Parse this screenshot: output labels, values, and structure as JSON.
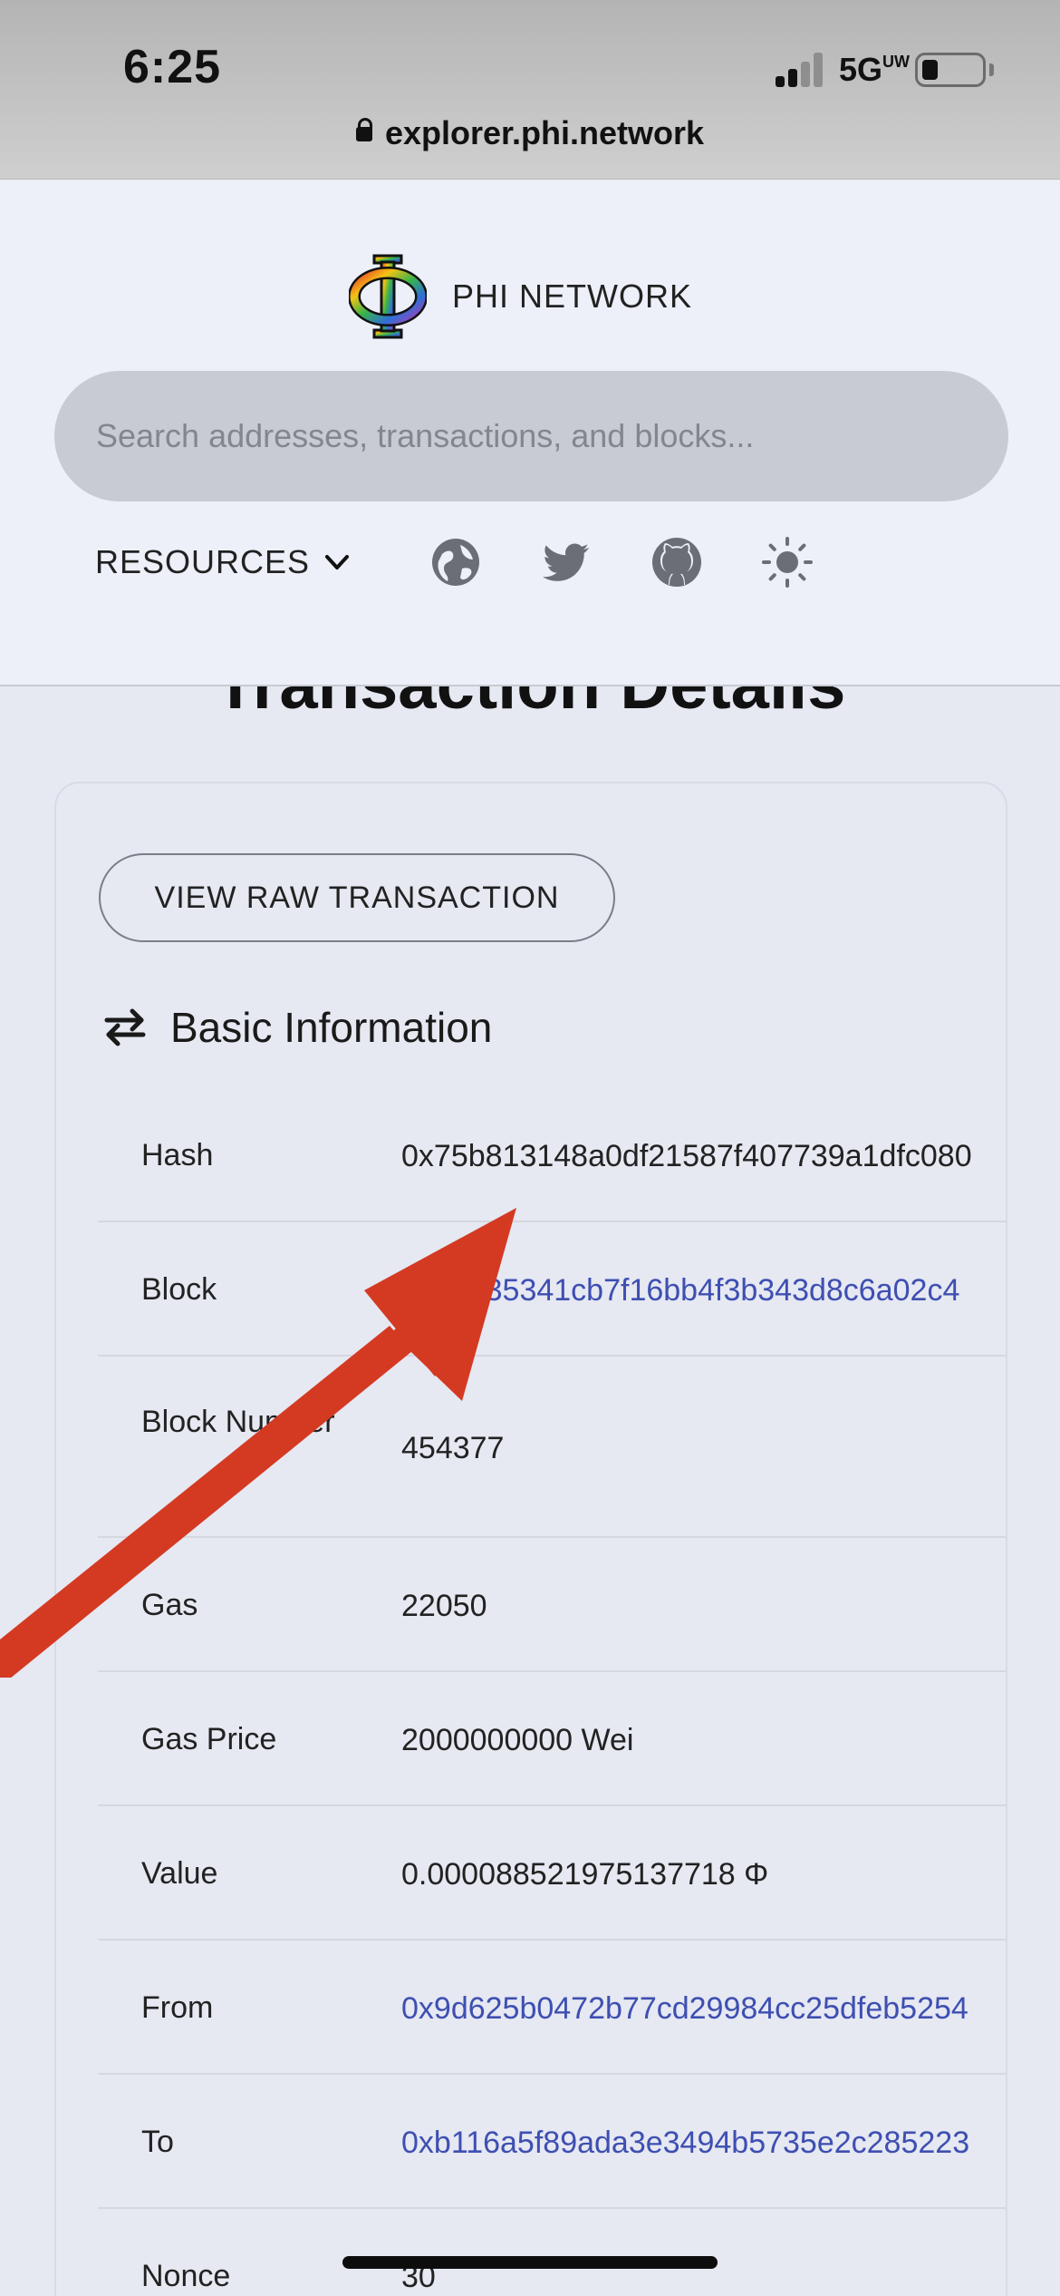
{
  "status_bar": {
    "time": "6:25",
    "network": "5G",
    "network_sup": "UW"
  },
  "browser": {
    "url": "explorer.phi.network"
  },
  "header": {
    "brand": "PHI NETWORK",
    "search_placeholder": "Search addresses, transactions, and blocks...",
    "resources_label": "RESOURCES",
    "icons": [
      "globe-icon",
      "twitter-icon",
      "github-icon",
      "theme-toggle-icon"
    ]
  },
  "page": {
    "title": "Transaction Details"
  },
  "card": {
    "raw_button": "VIEW RAW TRANSACTION",
    "section_title": "Basic Information",
    "rows": [
      {
        "label": "Hash",
        "value": "0x75b813148a0df21587f407739a1dfc080",
        "link": false
      },
      {
        "label": "Block",
        "value": "0xe3435341cb7f16bb4f3b343d8c6a02c4",
        "link": true
      },
      {
        "label": "Block Number",
        "value": "454377",
        "link": false
      },
      {
        "label": "Gas",
        "value": "22050",
        "link": false
      },
      {
        "label": "Gas Price",
        "value": "2000000000 Wei",
        "link": false
      },
      {
        "label": "Value",
        "value": "0.000088521975137718 Φ",
        "link": false
      },
      {
        "label": "From",
        "value": "0x9d625b0472b77cd29984cc25dfeb5254",
        "link": true
      },
      {
        "label": "To",
        "value": "0xb116a5f89ada3e3494b5735e2c285223",
        "link": true
      },
      {
        "label": "Nonce",
        "value": "30",
        "link": false
      }
    ]
  },
  "colors": {
    "accent_link": "#3e4fb1",
    "annotation_arrow": "#d43a22",
    "header_bg": "#edf0f9",
    "page_bg": "#e6e8f2"
  }
}
